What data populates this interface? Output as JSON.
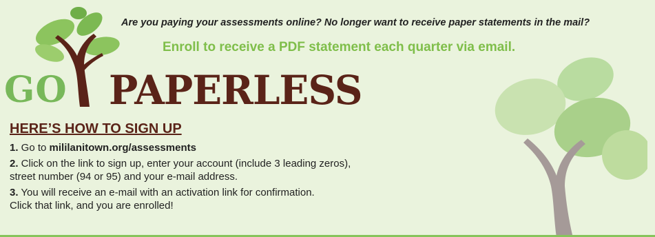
{
  "header": {
    "tagline": "Are you paying your assessments online? No longer want to receive paper statements in the mail?",
    "enroll_line": "Enroll to receive a PDF statement each quarter via email."
  },
  "logo": {
    "word_go": "GO",
    "word_paperless": "PAPERLESS",
    "icon": "sprout-tree-icon"
  },
  "instructions": {
    "heading": "HERE’S HOW TO SIGN UP",
    "steps": [
      {
        "num": "1.",
        "prefix": " Go to ",
        "link": "mililanitown.org/assessments",
        "rest": ""
      },
      {
        "num": "2.",
        "line1": " Click on the link to sign up, enter your account (include 3 leading zeros),",
        "line2": "street number (94 or 95) and your e-mail address."
      },
      {
        "num": "3.",
        "line1": " You will receive an e-mail with an activation link for confirmation.",
        "line2": "Click that link, and you are enrolled!"
      }
    ]
  },
  "decoration": {
    "icon": "tree-illustration-icon"
  },
  "colors": {
    "background": "#eaf3dd",
    "accent_green": "#7fbe4a",
    "brand_brown": "#5a2318"
  }
}
